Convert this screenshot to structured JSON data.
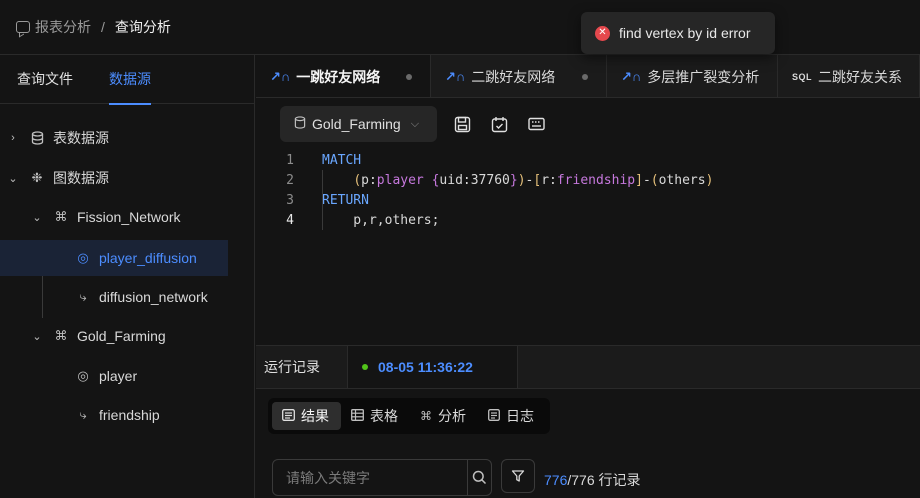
{
  "header": {
    "breadcrumb_parent": "报表分析",
    "breadcrumb_separator": "/",
    "breadcrumb_current": "查询分析"
  },
  "toast": {
    "message": "find vertex by id error",
    "icon": "error-icon",
    "color": "#e5484d"
  },
  "sidebar": {
    "tabs": [
      {
        "label": "查询文件",
        "active": false
      },
      {
        "label": "数据源",
        "active": true
      }
    ],
    "tree": [
      {
        "label": "表数据源",
        "icon": "database-icon",
        "level": 0,
        "expanded": false
      },
      {
        "label": "图数据源",
        "icon": "graph-source-icon",
        "level": 0,
        "expanded": true
      },
      {
        "label": "Fission_Network",
        "icon": "graph-icon",
        "level": 1,
        "expanded": true
      },
      {
        "label": "player_diffusion",
        "icon": "vertex-icon",
        "level": 2,
        "selected": true
      },
      {
        "label": "diffusion_network",
        "icon": "edge-icon",
        "level": 2
      },
      {
        "label": "Gold_Farming",
        "icon": "graph-icon",
        "level": 1,
        "expanded": true
      },
      {
        "label": "player",
        "icon": "vertex-icon",
        "level": 2
      },
      {
        "label": "friendship",
        "icon": "edge-icon",
        "level": 2
      }
    ]
  },
  "editor_tabs": [
    {
      "label": "一跳好友网络",
      "icon": "graph-query-icon",
      "active": true,
      "unsaved": true
    },
    {
      "label": "二跳好友网络",
      "icon": "graph-query-icon",
      "active": false,
      "unsaved": true
    },
    {
      "label": "多层推广裂变分析",
      "icon": "graph-query-icon",
      "active": false
    },
    {
      "label": "二跳好友关系",
      "icon": "sql-icon",
      "icon_text": "SQL",
      "active": false
    }
  ],
  "toolbar": {
    "datasource": "Gold_Farming",
    "buttons": [
      "save-icon",
      "calendar-check-icon",
      "keyboard-icon"
    ]
  },
  "code": {
    "lines": [
      {
        "n": "1",
        "text": "MATCH"
      },
      {
        "n": "2",
        "text": "    (p:player {uid:37760})-[r:friendship]-(others)"
      },
      {
        "n": "3",
        "text": "RETURN"
      },
      {
        "n": "4",
        "text": "    p,r,others;"
      }
    ]
  },
  "run_log": {
    "title": "运行记录",
    "entry_time": "08-05 11:36:22",
    "entry_status_color": "#52c41a",
    "view_tabs": [
      {
        "label": "结果",
        "icon": "list-icon",
        "active": true
      },
      {
        "label": "表格",
        "icon": "table-icon",
        "active": false
      },
      {
        "label": "分析",
        "icon": "graph-icon",
        "active": false
      },
      {
        "label": "日志",
        "icon": "log-icon",
        "active": false
      }
    ],
    "search_placeholder": "请输入关键字",
    "count_shown": "776",
    "count_total": "/776 行记录"
  }
}
